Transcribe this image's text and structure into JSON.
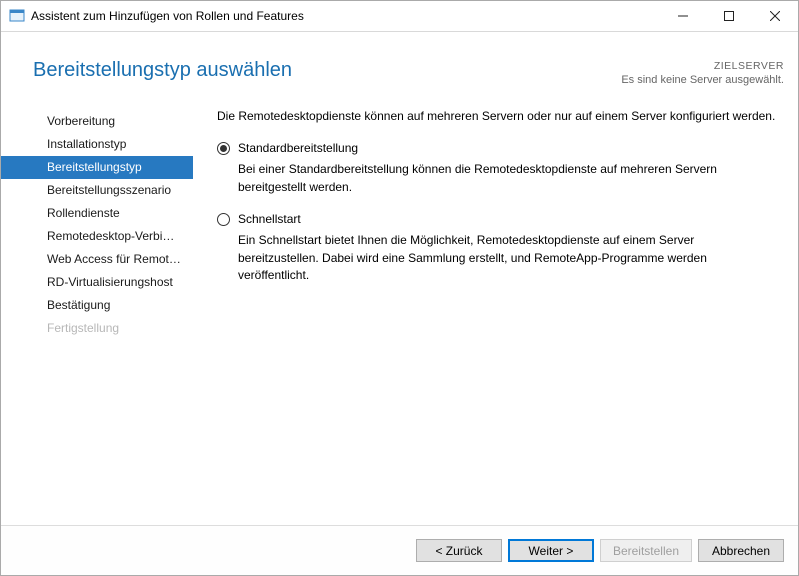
{
  "window": {
    "title": "Assistent zum Hinzufügen von Rollen und Features"
  },
  "header": {
    "title": "Bereitstellungstyp auswählen",
    "target_label": "ZIELSERVER",
    "target_status": "Es sind keine Server ausgewählt."
  },
  "sidebar": {
    "items": [
      {
        "label": "Vorbereitung"
      },
      {
        "label": "Installationstyp"
      },
      {
        "label": "Bereitstellungstyp"
      },
      {
        "label": "Bereitstellungsszenario"
      },
      {
        "label": "Rollendienste"
      },
      {
        "label": "Remotedesktop-Verbindu..."
      },
      {
        "label": "Web Access für Remoted..."
      },
      {
        "label": "RD-Virtualisierungshost"
      },
      {
        "label": "Bestätigung"
      },
      {
        "label": "Fertigstellung"
      }
    ]
  },
  "main": {
    "intro": "Die Remotedesktopdienste können auf mehreren Servern oder nur auf einem Server konfiguriert werden.",
    "options": [
      {
        "label": "Standardbereitstellung",
        "desc": "Bei einer Standardbereitstellung können die Remotedesktopdienste auf mehreren Servern bereitgestellt werden."
      },
      {
        "label": "Schnellstart",
        "desc": "Ein Schnellstart bietet Ihnen die Möglichkeit, Remotedesktopdienste auf einem Server bereitzustellen. Dabei wird eine Sammlung erstellt, und RemoteApp-Programme werden veröffentlicht."
      }
    ]
  },
  "footer": {
    "back": "< Zurück",
    "next": "Weiter >",
    "deploy": "Bereitstellen",
    "cancel": "Abbrechen"
  }
}
